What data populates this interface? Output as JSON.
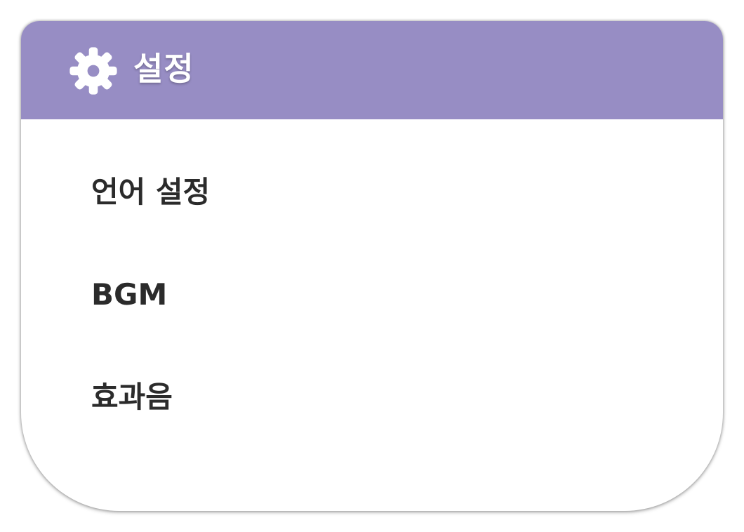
{
  "header": {
    "icon": "gear-icon",
    "title": "설정",
    "background": "#978dc4"
  },
  "menu": {
    "items": [
      {
        "label": "언어 설정"
      },
      {
        "label": "BGM"
      },
      {
        "label": "효과음"
      }
    ]
  }
}
